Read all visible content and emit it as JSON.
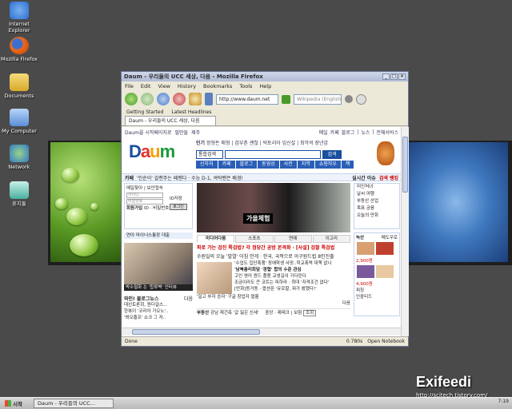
{
  "desktop": {
    "icons": [
      {
        "label": "Internet Explorer",
        "icon": "internet-explorer-icon",
        "color": "#2c6fd1"
      },
      {
        "label": "Mozilla Firefox",
        "icon": "firefox-icon",
        "color": "#e86a1c"
      },
      {
        "label": "Documents",
        "icon": "documents-folder-icon",
        "color": "#e8c24a"
      },
      {
        "label": "My Computer",
        "icon": "my-computer-icon",
        "color": "#5a8fd8"
      },
      {
        "label": "Network",
        "icon": "network-icon",
        "color": "#4a9a3a"
      },
      {
        "label": "휴지통",
        "icon": "recycle-bin-icon",
        "color": "#4ab0a0"
      }
    ]
  },
  "firefox": {
    "title": "Daum - 우리들의 UCC 세상, 다음 - Mozilla Firefox",
    "menu": [
      "File",
      "Edit",
      "View",
      "History",
      "Bookmarks",
      "Tools",
      "Help"
    ],
    "url": "http://www.daum.net",
    "search_placeholder": "Wikipedia (English)",
    "bookmarks": [
      "Getting Started",
      "Latest Headlines"
    ],
    "tab_label": "Daum - 우리들의 UCC 세상, 다음",
    "status_left": "Done",
    "status_time": "0.780s",
    "status_notebook": "Open Notebook"
  },
  "daum": {
    "top_left": "Daum을 시작페이지로",
    "top_left2": "필만들",
    "top_left3": "제주",
    "top_right": [
      "메일",
      "카페",
      "블로그",
      "|",
      "뉴스",
      "|",
      "전체서비스"
    ],
    "logo": "Daum",
    "popular_label": "인기",
    "popular": "정형돈 매형 | 검부촌 괜찮 | 빅토리아 임신설 | 최악의 장년감",
    "search_select": "통합검색",
    "search_button": "검색",
    "cats": [
      "신차처",
      "카페",
      "블로그",
      "동영상",
      "사전",
      "지역",
      "쇼핑하우",
      "책"
    ],
    "strip_label": "카페",
    "strip_text": "'인순이' 갈랜주는 페멘다 · 수능 D-1, 여탁밴은 배경!",
    "strip_right": "실시간 이슈",
    "strip_right2": "검색 랭킹",
    "login": {
      "line1": "메일찾아 | 보안접속",
      "id_placeholder": "아이디",
      "pw_placeholder": "비밀번호",
      "save": "ID저장",
      "button": "로그인",
      "join": "회원가입",
      "find": "ID · 비밀번호 찾기"
    },
    "blue_strip": "연아 마이너스통장 대출",
    "thumb_caption": "박수철화 논 '합류벽' 인터뷰",
    "blog_title": "와인! 블로그뉴스",
    "blog_more": "다음",
    "blog_items": [
      "대선토론회, 원더걸스...",
      "한복이 '코리아 가오노'..",
      "'봐오줄프' 쇼크 그 자.."
    ],
    "banner_tag": "가을체험",
    "news_tabs": [
      "미디어다음",
      "스포츠",
      "연예",
      "이고리"
    ],
    "headlines": [
      "파로 가는 검진 특검법? 각 정당간 공방 본격화 · [사설] 검찰 특검법",
      "수원일의 오늘 '발열' 아침 안개 · 한국, 국적으로 아구원드컵 8인진출"
    ],
    "news_lines": [
      "'수업도 집단폭행' 장애학생 사망..학교폭력 대책 없나",
      "'남북총리회담 '경협' 합의 수준 관심",
      "고인 영어 원드 플랜 교생길이 가다린다",
      "조금이라도 큰 코트는 피하라 · 최대 '자격조건 없다'",
      "[만화]동거동 · 팝션폰 '유로할, 뭐가 봤했다!'"
    ],
    "news_more": "다음",
    "thumb_sub": "'일고 부자 승자' 구글 창업자 열흘",
    "bottom_label": "부동산",
    "bottom_text": "강남 재건축 '값 잃은 신세'",
    "bottom_right": "중앙 · 제태크 | 보험",
    "bottom_btn": "조회",
    "right_items": [
      "미인처녀",
      "날씨 여행",
      "부동산 산업",
      "목표 금융",
      "오늘의 만화"
    ],
    "shop_title": "녹산",
    "shop_more": "메도우로",
    "shop_price1": "2,900원",
    "shop_price2": "4,900원",
    "shop_label": "피칭",
    "shop_label2": "인중티드"
  },
  "taskbar": {
    "start": "시작",
    "task": "Daum - 우리들의 UCC...",
    "clock": "7:19"
  },
  "watermark": {
    "text": "Exifeedi",
    "url": "http://scitech.tistory.com/"
  }
}
